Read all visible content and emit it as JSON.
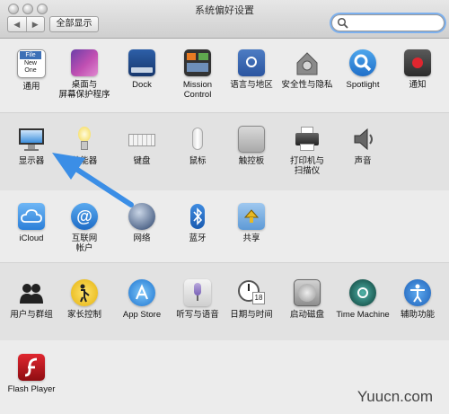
{
  "window": {
    "title": "系统偏好设置",
    "back_label": "◀",
    "forward_label": "▶",
    "show_all_label": "全部显示",
    "search_value": ""
  },
  "rows": [
    [
      {
        "label": "通用"
      },
      {
        "label": "桌面与",
        "label2": "屏幕保护程序"
      },
      {
        "label": "Dock"
      },
      {
        "label": "Mission",
        "label2": "Control"
      },
      {
        "label": "语言与地区"
      },
      {
        "label": "安全性与隐私"
      },
      {
        "label": "Spotlight"
      },
      {
        "label": "通知"
      }
    ],
    [
      {
        "label": "显示器"
      },
      {
        "label": "节能器"
      },
      {
        "label": "键盘"
      },
      {
        "label": "鼠标"
      },
      {
        "label": "触控板"
      },
      {
        "label": "打印机与",
        "label2": "扫描仪"
      },
      {
        "label": "声音"
      }
    ],
    [
      {
        "label": "iCloud"
      },
      {
        "label": "互联网",
        "label2": "帐户"
      },
      {
        "label": "网络"
      },
      {
        "label": "蓝牙"
      },
      {
        "label": "共享"
      }
    ],
    [
      {
        "label": "用户与群组"
      },
      {
        "label": "家长控制"
      },
      {
        "label": "App Store"
      },
      {
        "label": "听写与语音"
      },
      {
        "label": "日期与时间"
      },
      {
        "label": "启动磁盘"
      },
      {
        "label": "Time Machine"
      },
      {
        "label": "辅助功能"
      }
    ],
    [
      {
        "label": "Flash Player"
      }
    ]
  ],
  "icon_text": {
    "general_file": "File",
    "general_new": "New",
    "general_one": "One",
    "date_day": "18"
  },
  "watermark": "Yuucn.com",
  "colors": {
    "arrow": "#3b8ee6",
    "search_focus": "#7cb0ee"
  }
}
